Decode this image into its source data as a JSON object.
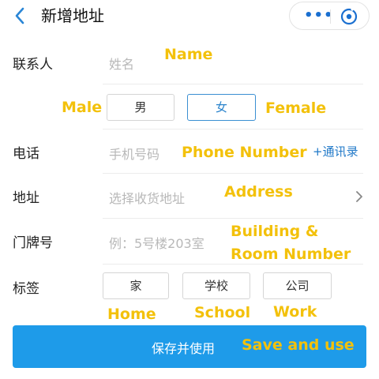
{
  "header": {
    "title": "新增地址",
    "more_label": "•••"
  },
  "form": {
    "contact_label": "联系人",
    "name_placeholder": "姓名",
    "gender_options": [
      "男",
      "女"
    ],
    "gender_selected": "女",
    "phone_label": "电话",
    "phone_placeholder": "手机号码",
    "contacts_link": "+通讯录",
    "address_label": "地址",
    "address_placeholder": "选择收货地址",
    "room_label": "门牌号",
    "room_placeholder": "例：5号楼203室",
    "tag_label": "标签",
    "tags": [
      "家",
      "学校",
      "公司"
    ]
  },
  "save_button_label": "保存并使用",
  "annotations": {
    "name": "Name",
    "male": "Male",
    "female": "Female",
    "phone": "Phone Number",
    "address": "Address",
    "room_line1": "Building &",
    "room_line2": "Room Number",
    "home": "Home",
    "school": "School",
    "work": "Work",
    "save": "Save and use"
  },
  "colors": {
    "accent": "#1e9be9",
    "link": "#1f78c8",
    "annotation": "#f3c10b",
    "placeholder": "#b8b8b8"
  },
  "icons": {
    "back": "chevron-left-icon",
    "more": "more-dots-icon",
    "close": "close-target-icon",
    "address_chevron": "chevron-right-icon"
  }
}
